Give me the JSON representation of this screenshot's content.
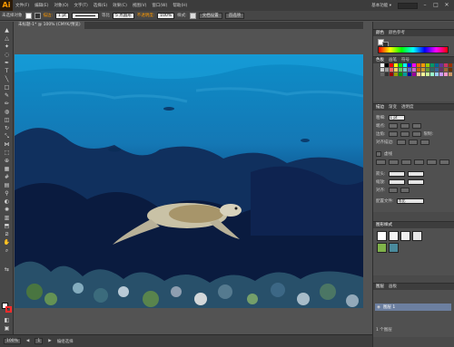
{
  "app": {
    "logo": "Ai",
    "menus": [
      "文件(F)",
      "编辑(E)",
      "对象(O)",
      "文字(T)",
      "选择(S)",
      "效果(C)",
      "视图(V)",
      "窗口(W)",
      "帮助(H)"
    ],
    "workspace": "基本功能 ▾"
  },
  "controlbar": {
    "selection_label": "未选择对象",
    "stroke_label": "描边:",
    "stroke_weight": "1 pt",
    "profile_label": "等比",
    "brush_label": "5 点圆形",
    "opacity_label": "不透明度:",
    "opacity_value": "100%",
    "style_label": "样式:",
    "doc_setup_button": "文档设置",
    "prefs_button": "首选项"
  },
  "tab": {
    "title": "未标题-1* @ 100% (CMYK/预览)"
  },
  "statusbar": {
    "zoom": "100%",
    "page": "1",
    "tool_name": "编组选择"
  },
  "panels": {
    "color": {
      "tabs": [
        "颜色",
        "颜色参考"
      ]
    },
    "swatches": {
      "tabs": [
        "色板",
        "画笔",
        "符号"
      ]
    },
    "stroke": {
      "tabs": [
        "描边",
        "渐变",
        "透明度"
      ],
      "weight_label": "粗细:",
      "weight_value": "1 pt",
      "cap_label": "端点:",
      "corner_label": "边角:",
      "limit_label": "限制:",
      "align_label": "对齐描边:",
      "dashed_label": "虚线",
      "arrow_label": "箭头:",
      "scale_label": "缩放:",
      "align2_label": "对齐:",
      "profile_label": "配置文件:",
      "profile_value": "等比"
    },
    "image_trace": {
      "tabs": [
        "图形样式"
      ]
    },
    "layers": {
      "tabs": [
        "图层",
        "画板"
      ],
      "layer_name": "图层 1",
      "count_label": "1 个图层"
    }
  },
  "colors": {
    "accent": "#ff9a00",
    "stroke_swatch": "#ff2b2b",
    "fill_swatch": "#ffffff",
    "canvas_bg": "#535353"
  },
  "swatch_colors": [
    "#ffffff",
    "#000000",
    "#ff0000",
    "#ffff00",
    "#00ff00",
    "#00ffff",
    "#0000ff",
    "#ff00ff",
    "#ff6600",
    "#ff9900",
    "#99cc00",
    "#009966",
    "#006699",
    "#663399",
    "#cc3366",
    "#993300",
    "#cccccc",
    "#999999",
    "#ff6666",
    "#ffcc66",
    "#66cc66",
    "#66cccc",
    "#6666cc",
    "#cc66cc",
    "#cc6600",
    "#cc9933",
    "#669933",
    "#336666",
    "#336699",
    "#663366",
    "#996633",
    "#663300",
    "#666666",
    "#333333",
    "#990000",
    "#999900",
    "#009900",
    "#009999",
    "#000099",
    "#990099",
    "#ffcc99",
    "#ffff99",
    "#ccff99",
    "#99ffcc",
    "#99ccff",
    "#cc99ff",
    "#ff99cc",
    "#cc9966"
  ]
}
